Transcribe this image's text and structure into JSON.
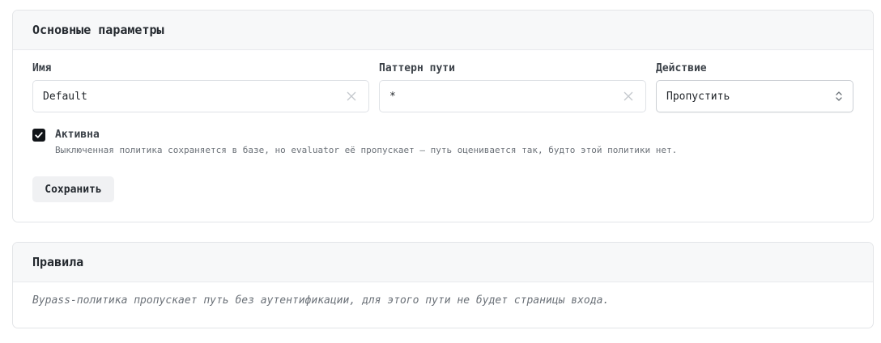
{
  "main_section": {
    "title": "Основные параметры",
    "fields": {
      "name": {
        "label": "Имя",
        "value": "Default"
      },
      "path_pattern": {
        "label": "Паттерн пути",
        "value": "*"
      },
      "action": {
        "label": "Действие",
        "value": "Пропустить"
      }
    },
    "active": {
      "checked": true,
      "label": "Активна",
      "description": "Выключенная политика сохраняется в базе, но evaluator её пропускает — путь оценивается так, будто этой политики нет."
    },
    "save_label": "Сохранить"
  },
  "rules_section": {
    "title": "Правила",
    "note": "Bypass-политика пропускает путь без аутентификации, для этого пути не будет страницы входа."
  },
  "colors": {
    "checkbox_fill": "#111418",
    "header_bg": "#f7f8f9",
    "border": "#e3e5e8"
  }
}
